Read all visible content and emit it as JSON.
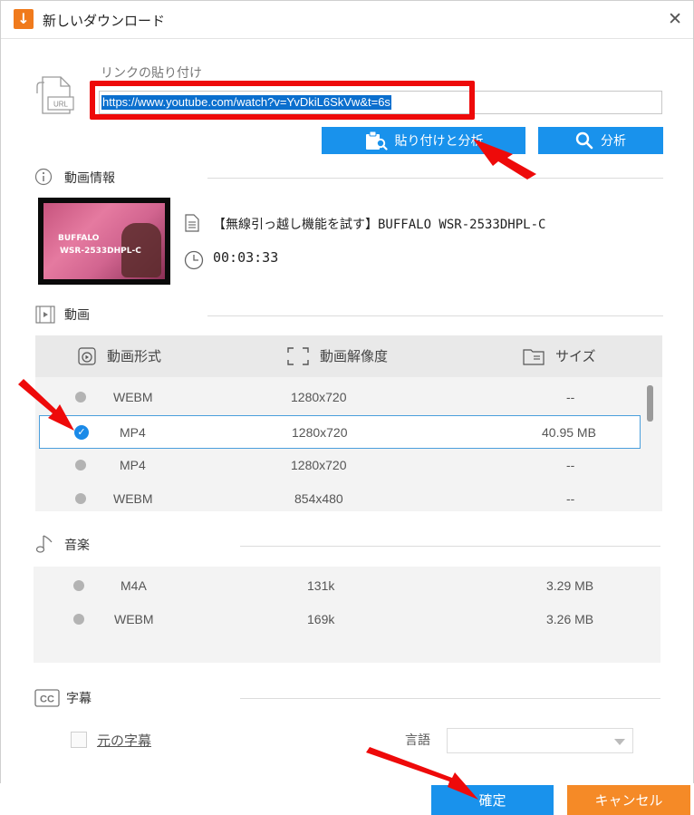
{
  "window": {
    "title": "新しいダウンロード",
    "close_glyph": "✕"
  },
  "link": {
    "label": "リンクの貼り付け",
    "url": "https://www.youtube.com/watch?v=YvDkiL6SkVw&t=6s",
    "url_icon_text": "URL",
    "paste_analyze_label": "貼り付けと分析",
    "analyze_label": "分析"
  },
  "video_info": {
    "section_label": "動画情報",
    "title": "【無線引っ越し機能を試す】BUFFALO WSR-2533DHPL-C",
    "duration": "00:03:33",
    "thumbnail_text": [
      "BUFFALO",
      "WSR-2533DHPL-C"
    ]
  },
  "video": {
    "section_label": "動画",
    "headers": {
      "format": "動画形式",
      "resolution": "動画解像度",
      "size": "サイズ"
    },
    "rows": [
      {
        "format": "WEBM",
        "resolution": "1280x720",
        "size": "--",
        "selected": false
      },
      {
        "format": "MP4",
        "resolution": "1280x720",
        "size": "40.95 MB",
        "selected": true
      },
      {
        "format": "MP4",
        "resolution": "1280x720",
        "size": "--",
        "selected": false
      },
      {
        "format": "WEBM",
        "resolution": "854x480",
        "size": "--",
        "selected": false
      }
    ]
  },
  "audio": {
    "section_label": "音楽",
    "rows": [
      {
        "format": "M4A",
        "bitrate": "131k",
        "size": "3.29 MB"
      },
      {
        "format": "WEBM",
        "bitrate": "169k",
        "size": "3.26 MB"
      }
    ]
  },
  "subtitles": {
    "section_label": "字幕",
    "original_label": "元の字幕",
    "language_label": "言語",
    "language_value": ""
  },
  "footer": {
    "ok_label": "確定",
    "cancel_label": "キャンセル"
  },
  "colors": {
    "accent": "#1992ec",
    "cancel": "#f58a27",
    "annotation": "#ee0a0a"
  }
}
